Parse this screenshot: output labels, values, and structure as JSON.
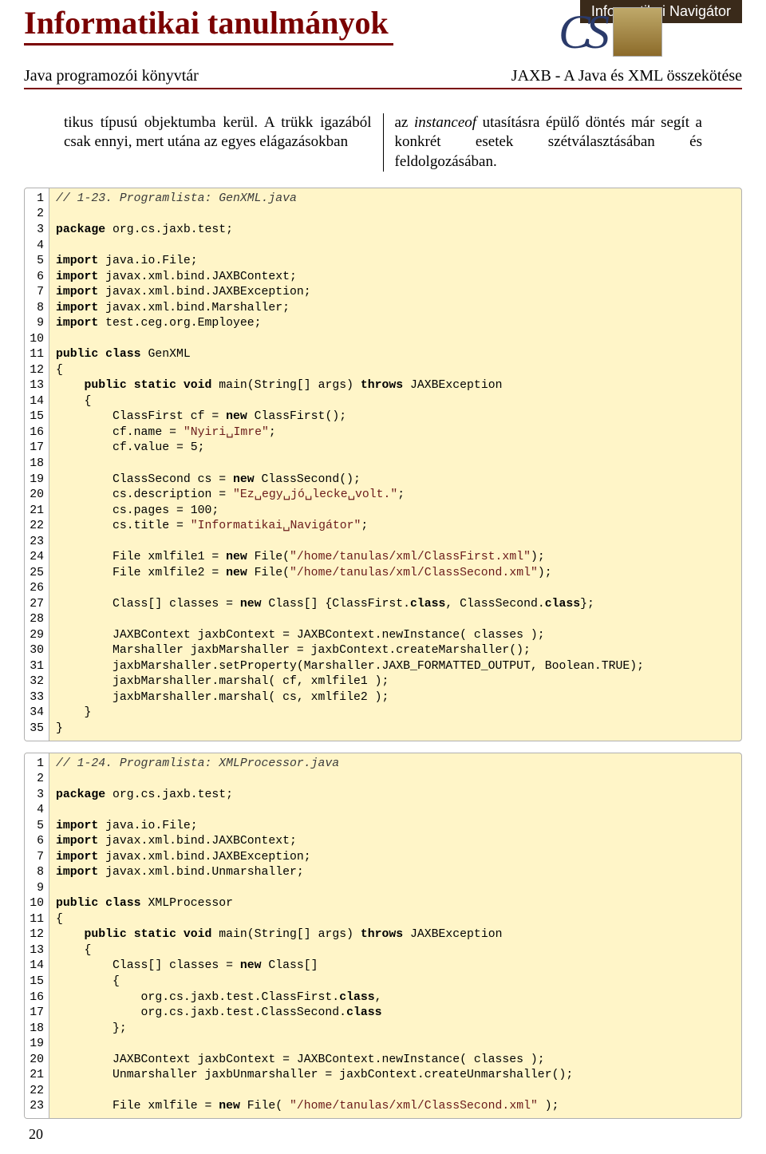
{
  "banner": {
    "title": "Informatikai tanulmányok",
    "nav_label": "Informatikai Navigátor",
    "row2_left": "Java programozói könyvtár",
    "row2_right": "JAXB - A Java és XML összekötése"
  },
  "columns": {
    "left": "tikus típusú objektumba kerül. A trükk igazából csak ennyi, mert utána az egyes elágazásokban",
    "right_pre": "az ",
    "right_italic": "instanceof",
    "right_post": " utasításra épülő döntés már segít a konkrét esetek szétválasztásában és feldolgozásában."
  },
  "code1": {
    "lines": [
      {
        "n": "1",
        "t": "cm",
        "c": "// 1-23. Programlista: GenXML.java"
      },
      {
        "n": "2",
        "t": "",
        "c": ""
      },
      {
        "n": "3",
        "t": "mix",
        "c": [
          {
            "k": "package"
          },
          {
            "p": " org.cs.jaxb.test;"
          }
        ]
      },
      {
        "n": "4",
        "t": "",
        "c": ""
      },
      {
        "n": "5",
        "t": "mix",
        "c": [
          {
            "k": "import"
          },
          {
            "p": " java.io.File;"
          }
        ]
      },
      {
        "n": "6",
        "t": "mix",
        "c": [
          {
            "k": "import"
          },
          {
            "p": " javax.xml.bind.JAXBContext;"
          }
        ]
      },
      {
        "n": "7",
        "t": "mix",
        "c": [
          {
            "k": "import"
          },
          {
            "p": " javax.xml.bind.JAXBException;"
          }
        ]
      },
      {
        "n": "8",
        "t": "mix",
        "c": [
          {
            "k": "import"
          },
          {
            "p": " javax.xml.bind.Marshaller;"
          }
        ]
      },
      {
        "n": "9",
        "t": "mix",
        "c": [
          {
            "k": "import"
          },
          {
            "p": " test.ceg.org.Employee;"
          }
        ]
      },
      {
        "n": "10",
        "t": "",
        "c": ""
      },
      {
        "n": "11",
        "t": "mix",
        "c": [
          {
            "k": "public class"
          },
          {
            "p": " GenXML"
          }
        ]
      },
      {
        "n": "12",
        "t": "",
        "c": "{"
      },
      {
        "n": "13",
        "t": "mix",
        "c": [
          {
            "p": "    "
          },
          {
            "k": "public static void"
          },
          {
            "p": " main(String[] args) "
          },
          {
            "k": "throws"
          },
          {
            "p": " JAXBException"
          }
        ]
      },
      {
        "n": "14",
        "t": "",
        "c": "    {"
      },
      {
        "n": "15",
        "t": "mix",
        "c": [
          {
            "p": "        ClassFirst cf = "
          },
          {
            "k": "new"
          },
          {
            "p": " ClassFirst();"
          }
        ]
      },
      {
        "n": "16",
        "t": "mix",
        "c": [
          {
            "p": "        cf.name = "
          },
          {
            "s": "\"Nyiri␣Imre\""
          },
          {
            "p": ";"
          }
        ]
      },
      {
        "n": "17",
        "t": "",
        "c": "        cf.value = 5;"
      },
      {
        "n": "18",
        "t": "",
        "c": ""
      },
      {
        "n": "19",
        "t": "mix",
        "c": [
          {
            "p": "        ClassSecond cs = "
          },
          {
            "k": "new"
          },
          {
            "p": " ClassSecond();"
          }
        ]
      },
      {
        "n": "20",
        "t": "mix",
        "c": [
          {
            "p": "        cs.description = "
          },
          {
            "s": "\"Ez␣egy␣jó␣lecke␣volt.\""
          },
          {
            "p": ";"
          }
        ]
      },
      {
        "n": "21",
        "t": "",
        "c": "        cs.pages = 100;"
      },
      {
        "n": "22",
        "t": "mix",
        "c": [
          {
            "p": "        cs.title = "
          },
          {
            "s": "\"Informatikai␣Navigátor\""
          },
          {
            "p": ";"
          }
        ]
      },
      {
        "n": "23",
        "t": "",
        "c": ""
      },
      {
        "n": "24",
        "t": "mix",
        "c": [
          {
            "p": "        File xmlfile1 = "
          },
          {
            "k": "new"
          },
          {
            "p": " File("
          },
          {
            "s": "\"/home/tanulas/xml/ClassFirst.xml\""
          },
          {
            "p": ");"
          }
        ]
      },
      {
        "n": "25",
        "t": "mix",
        "c": [
          {
            "p": "        File xmlfile2 = "
          },
          {
            "k": "new"
          },
          {
            "p": " File("
          },
          {
            "s": "\"/home/tanulas/xml/ClassSecond.xml\""
          },
          {
            "p": ");"
          }
        ]
      },
      {
        "n": "26",
        "t": "",
        "c": ""
      },
      {
        "n": "27",
        "t": "mix",
        "c": [
          {
            "p": "        Class[] classes = "
          },
          {
            "k": "new"
          },
          {
            "p": " Class[] {ClassFirst."
          },
          {
            "k": "class"
          },
          {
            "p": ", ClassSecond."
          },
          {
            "k": "class"
          },
          {
            "p": "};"
          }
        ]
      },
      {
        "n": "28",
        "t": "",
        "c": ""
      },
      {
        "n": "29",
        "t": "",
        "c": "        JAXBContext jaxbContext = JAXBContext.newInstance( classes );"
      },
      {
        "n": "30",
        "t": "",
        "c": "        Marshaller jaxbMarshaller = jaxbContext.createMarshaller();"
      },
      {
        "n": "31",
        "t": "",
        "c": "        jaxbMarshaller.setProperty(Marshaller.JAXB_FORMATTED_OUTPUT, Boolean.TRUE);"
      },
      {
        "n": "32",
        "t": "",
        "c": "        jaxbMarshaller.marshal( cf, xmlfile1 );"
      },
      {
        "n": "33",
        "t": "",
        "c": "        jaxbMarshaller.marshal( cs, xmlfile2 );"
      },
      {
        "n": "34",
        "t": "",
        "c": "    }"
      },
      {
        "n": "35",
        "t": "",
        "c": "}"
      }
    ]
  },
  "code2": {
    "lines": [
      {
        "n": "1",
        "t": "cm",
        "c": "// 1-24. Programlista: XMLProcessor.java"
      },
      {
        "n": "2",
        "t": "",
        "c": ""
      },
      {
        "n": "3",
        "t": "mix",
        "c": [
          {
            "k": "package"
          },
          {
            "p": " org.cs.jaxb.test;"
          }
        ]
      },
      {
        "n": "4",
        "t": "",
        "c": ""
      },
      {
        "n": "5",
        "t": "mix",
        "c": [
          {
            "k": "import"
          },
          {
            "p": " java.io.File;"
          }
        ]
      },
      {
        "n": "6",
        "t": "mix",
        "c": [
          {
            "k": "import"
          },
          {
            "p": " javax.xml.bind.JAXBContext;"
          }
        ]
      },
      {
        "n": "7",
        "t": "mix",
        "c": [
          {
            "k": "import"
          },
          {
            "p": " javax.xml.bind.JAXBException;"
          }
        ]
      },
      {
        "n": "8",
        "t": "mix",
        "c": [
          {
            "k": "import"
          },
          {
            "p": " javax.xml.bind.Unmarshaller;"
          }
        ]
      },
      {
        "n": "9",
        "t": "",
        "c": ""
      },
      {
        "n": "10",
        "t": "mix",
        "c": [
          {
            "k": "public class"
          },
          {
            "p": " XMLProcessor"
          }
        ]
      },
      {
        "n": "11",
        "t": "",
        "c": "{"
      },
      {
        "n": "12",
        "t": "mix",
        "c": [
          {
            "p": "    "
          },
          {
            "k": "public static void"
          },
          {
            "p": " main(String[] args) "
          },
          {
            "k": "throws"
          },
          {
            "p": " JAXBException"
          }
        ]
      },
      {
        "n": "13",
        "t": "",
        "c": "    {"
      },
      {
        "n": "14",
        "t": "mix",
        "c": [
          {
            "p": "        Class[] classes = "
          },
          {
            "k": "new"
          },
          {
            "p": " Class[]"
          }
        ]
      },
      {
        "n": "15",
        "t": "",
        "c": "        {"
      },
      {
        "n": "16",
        "t": "mix",
        "c": [
          {
            "p": "            org.cs.jaxb.test.ClassFirst."
          },
          {
            "k": "class"
          },
          {
            "p": ","
          }
        ]
      },
      {
        "n": "17",
        "t": "mix",
        "c": [
          {
            "p": "            org.cs.jaxb.test.ClassSecond."
          },
          {
            "k": "class"
          }
        ]
      },
      {
        "n": "18",
        "t": "",
        "c": "        };"
      },
      {
        "n": "19",
        "t": "",
        "c": ""
      },
      {
        "n": "20",
        "t": "",
        "c": "        JAXBContext jaxbContext = JAXBContext.newInstance( classes );"
      },
      {
        "n": "21",
        "t": "",
        "c": "        Unmarshaller jaxbUnmarshaller = jaxbContext.createUnmarshaller();"
      },
      {
        "n": "22",
        "t": "",
        "c": ""
      },
      {
        "n": "23",
        "t": "mix",
        "c": [
          {
            "p": "        File xmlfile = "
          },
          {
            "k": "new"
          },
          {
            "p": " File( "
          },
          {
            "s": "\"/home/tanulas/xml/ClassSecond.xml\""
          },
          {
            "p": " );"
          }
        ]
      }
    ]
  },
  "page_number": "20"
}
